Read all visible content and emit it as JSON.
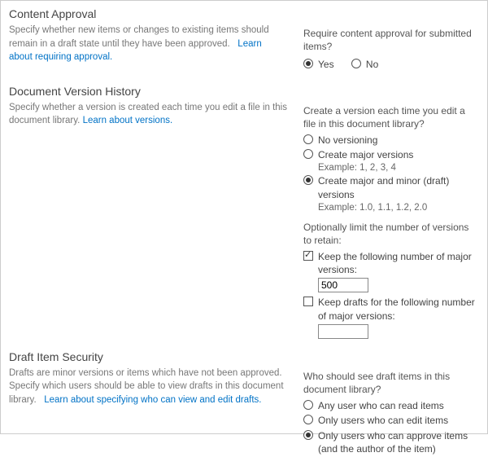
{
  "contentApproval": {
    "title": "Content Approval",
    "desc": "Specify whether new items or changes to existing items should remain in a draft state until they have been approved.",
    "link": "Learn about requiring approval.",
    "question": "Require content approval for submitted items?",
    "yes": "Yes",
    "no": "No"
  },
  "versionHistory": {
    "title": "Document Version History",
    "desc": "Specify whether a version is created each time you edit a file in this document library.",
    "link": "Learn about versions.",
    "q1": "Create a version each time you edit a file in this document library?",
    "optNone": "No versioning",
    "optMajor": "Create major versions",
    "exMajor": "Example: 1, 2, 3, 4",
    "optMajorMinor": "Create major and minor (draft) versions",
    "exMajorMinor": "Example: 1.0, 1.1, 1.2, 2.0",
    "q2": "Optionally limit the number of versions to retain:",
    "chkMajor": "Keep the following number of major versions:",
    "valMajor": "500",
    "chkDrafts": "Keep drafts for the following number of major versions:",
    "valDrafts": ""
  },
  "draftSecurity": {
    "title": "Draft Item Security",
    "desc": "Drafts are minor versions or items which have not been approved. Specify which users should be able to view drafts in this document library.",
    "link": "Learn about specifying who can view and edit drafts.",
    "question": "Who should see draft items in this document library?",
    "optRead": "Any user who can read items",
    "optEdit": "Only users who can edit items",
    "optApprove": "Only users who can approve items (and the author of the item)"
  }
}
